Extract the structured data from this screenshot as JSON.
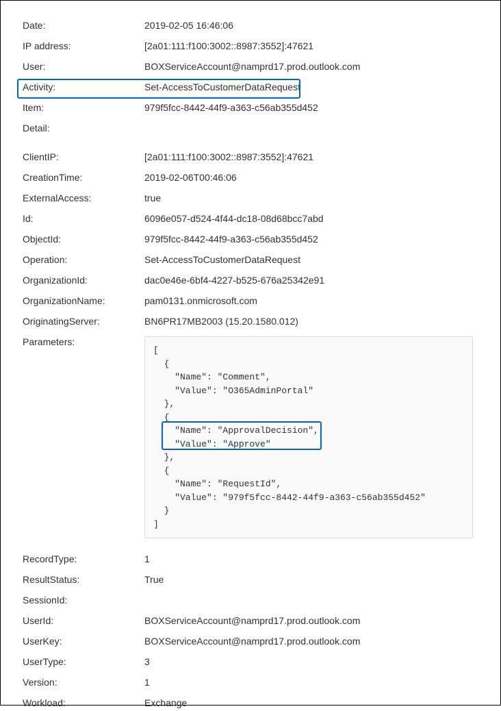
{
  "top": {
    "date_label": "Date:",
    "date_value": "2019-02-05 16:46:06",
    "ip_label": "IP address:",
    "ip_value": "[2a01:111:f100:3002::8987:3552]:47621",
    "user_label": "User:",
    "user_value": "BOXServiceAccount@namprd17.prod.outlook.com",
    "activity_label": "Activity:",
    "activity_value": "Set-AccessToCustomerDataRequest",
    "item_label": "Item:",
    "item_value": "979f5fcc-8442-44f9-a363-c56ab355d452",
    "detail_label": "Detail:"
  },
  "detail": {
    "clientip_label": "ClientIP:",
    "clientip_value": "[2a01:111:f100:3002::8987:3552]:47621",
    "creationtime_label": "CreationTime:",
    "creationtime_value": "2019-02-06T00:46:06",
    "externalaccess_label": "ExternalAccess:",
    "externalaccess_value": "true",
    "id_label": "Id:",
    "id_value": "6096e057-d524-4f44-dc18-08d68bcc7abd",
    "objectid_label": "ObjectId:",
    "objectid_value": "979f5fcc-8442-44f9-a363-c56ab355d452",
    "operation_label": "Operation:",
    "operation_value": "Set-AccessToCustomerDataRequest",
    "organizationid_label": "OrganizationId:",
    "organizationid_value": "dac0e46e-6bf4-4227-b525-676a25342e91",
    "organizationname_label": "OrganizationName:",
    "organizationname_value": "pam0131.onmicrosoft.com",
    "originatingserver_label": "OriginatingServer:",
    "originatingserver_value": "BN6PR17MB2003 (15.20.1580.012)",
    "parameters_label": "Parameters:",
    "parameters_code_l1": "[",
    "parameters_code_l2": "  {",
    "parameters_code_l3": "    \"Name\": \"Comment\",",
    "parameters_code_l4": "    \"Value\": \"O365AdminPortal\"",
    "parameters_code_l5": "  },",
    "parameters_code_l6": "  {",
    "parameters_code_l7": "    \"Name\": \"ApprovalDecision\",",
    "parameters_code_l8": "    \"Value\": \"Approve\"",
    "parameters_code_l9": "  },",
    "parameters_code_l10": "  {",
    "parameters_code_l11": "    \"Name\": \"RequestId\",",
    "parameters_code_l12": "    \"Value\": \"979f5fcc-8442-44f9-a363-c56ab355d452\"",
    "parameters_code_l13": "  }",
    "parameters_code_l14": "]",
    "recordtype_label": "RecordType:",
    "recordtype_value": "1",
    "resultstatus_label": "ResultStatus:",
    "resultstatus_value": "True",
    "sessionid_label": "SessionId:",
    "sessionid_value": "",
    "userid_label": "UserId:",
    "userid_value": "BOXServiceAccount@namprd17.prod.outlook.com",
    "userkey_label": "UserKey:",
    "userkey_value": "BOXServiceAccount@namprd17.prod.outlook.com",
    "usertype_label": "UserType:",
    "usertype_value": "3",
    "version_label": "Version:",
    "version_value": "1",
    "workload_label": "Workload:",
    "workload_value": "Exchange"
  }
}
